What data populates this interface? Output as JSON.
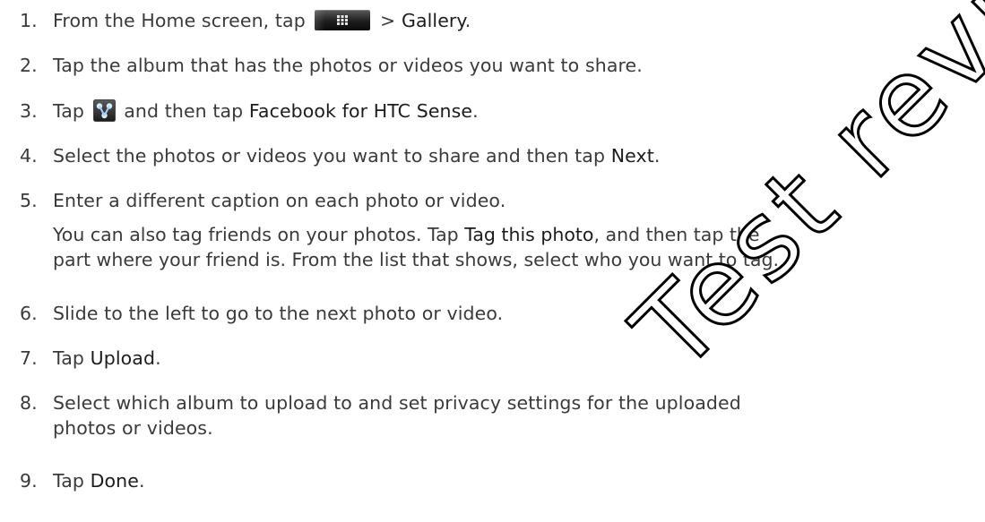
{
  "steps": [
    {
      "number": "1.",
      "text_before": "From the Home screen, tap ",
      "text_after": " > ",
      "keyword": "Gallery",
      "end": "."
    },
    {
      "number": "2.",
      "text": "Tap the album that has the photos or videos you want to share."
    },
    {
      "number": "3.",
      "text_before": "Tap ",
      "text_after": " and then tap ",
      "keyword": "Facebook for HTC Sense",
      "end": "."
    },
    {
      "number": "4.",
      "text_before": "Select the photos or videos you want to share and then tap ",
      "keyword": "Next",
      "end": "."
    },
    {
      "number": "5.",
      "text": "Enter a different caption on each photo or video.",
      "sub_line1_before": "You can also tag friends on your photos. Tap ",
      "sub_keyword": "Tag this photo",
      "sub_line1_after": ", and then tap the",
      "sub_line2": "part where your friend is. From the list that shows, select who you want to tag."
    },
    {
      "number": "6.",
      "text": "Slide to the left to go to the next photo or video."
    },
    {
      "number": "7.",
      "text_before": "Tap ",
      "keyword": "Upload",
      "end": "."
    },
    {
      "number": "8.",
      "line1": "Select which album to upload to and set privacy settings for the uploaded",
      "line2": "photos or videos."
    },
    {
      "number": "9.",
      "text_before": "Tap ",
      "keyword": "Done",
      "end": "."
    }
  ],
  "icons": {
    "all_apps": "all-apps-icon",
    "share": "share-icon"
  },
  "watermark": {
    "text": "Test review",
    "color": "#000000"
  }
}
